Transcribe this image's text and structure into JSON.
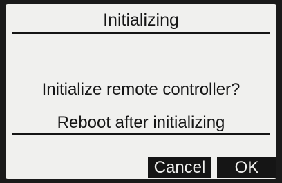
{
  "header": {
    "title": "Initializing"
  },
  "body": {
    "question": "Initialize remote controller?",
    "note": "Reboot after initializing"
  },
  "softkeys": {
    "cancel_label": "Cancel",
    "ok_label": "OK"
  },
  "colors": {
    "screen_background": "#f0f0ee",
    "text": "#151515",
    "bezel": "#1a1a1a"
  }
}
